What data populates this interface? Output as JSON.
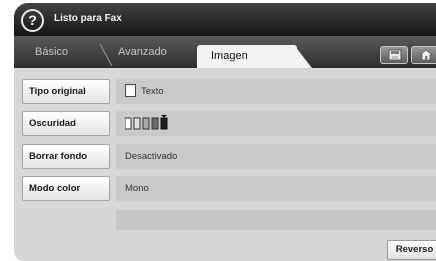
{
  "title_bar": {
    "help_icon_glyph": "?",
    "status": "Listo para Fax"
  },
  "tabs": [
    {
      "label": "Básico",
      "active": false
    },
    {
      "label": "Avanzado",
      "active": false
    },
    {
      "label": "Imagen",
      "active": true
    }
  ],
  "toolbar_icons": [
    "save-icon",
    "home-icon"
  ],
  "settings": [
    {
      "label": "Tipo original",
      "value": "Texto",
      "value_icon": "document-icon"
    },
    {
      "label": "Oscuridad",
      "value": "",
      "level": 4,
      "levels": 5
    },
    {
      "label": "Borrar fondo",
      "value": "Desactivado"
    },
    {
      "label": "Modo color",
      "value": "Mono"
    }
  ],
  "reverse_button": "Reverso"
}
